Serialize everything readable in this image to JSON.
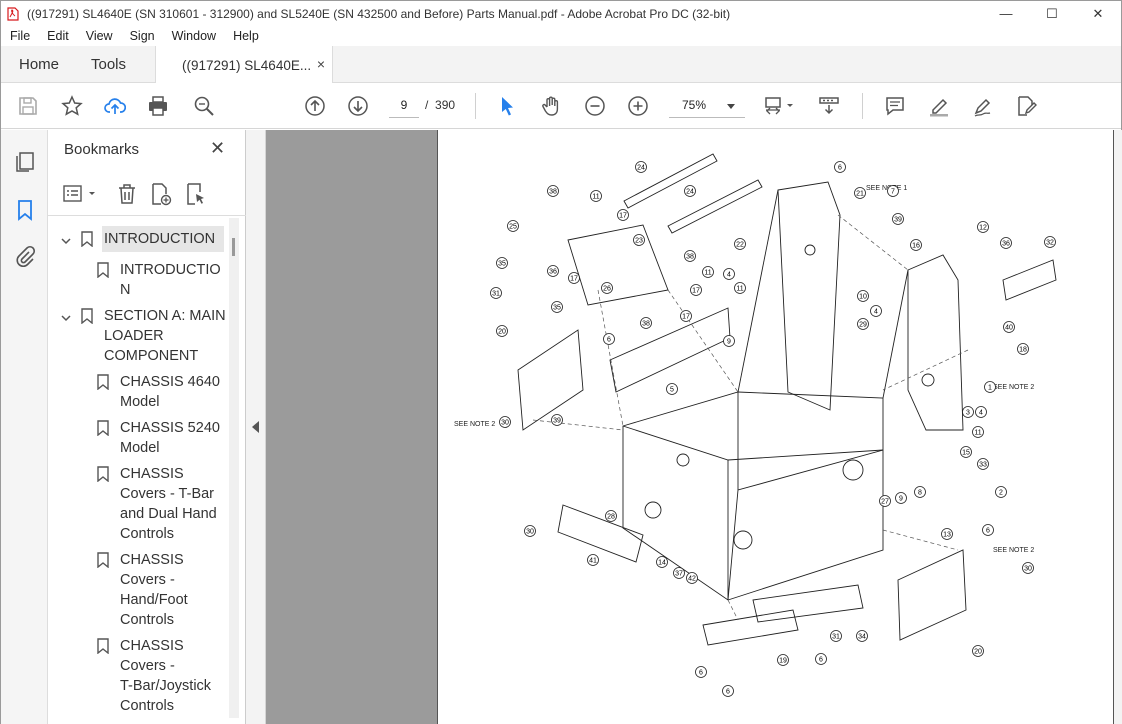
{
  "window": {
    "title": "((917291) SL4640E (SN 310601 - 312900) and SL5240E (SN 432500 and Before) Parts Manual.pdf - Adobe Acrobat Pro DC (32-bit)",
    "controls": [
      "—",
      "☐",
      "✕"
    ]
  },
  "menu": [
    "File",
    "Edit",
    "View",
    "Sign",
    "Window",
    "Help"
  ],
  "tabs": {
    "home": "Home",
    "tools": "Tools",
    "document": "((917291) SL4640E...",
    "close": "×"
  },
  "toolbar": {
    "current_page": "9",
    "page_separator": "/",
    "total_pages": "390",
    "zoom": "75%"
  },
  "bookmarks": {
    "title": "Bookmarks",
    "close": "✕",
    "items": [
      {
        "lines": [
          "INTRODUCTION"
        ],
        "level": 0,
        "expanded": true,
        "selected": true
      },
      {
        "lines": [
          "INTRODUCTIO",
          "N"
        ],
        "level": 1
      },
      {
        "lines": [
          "SECTION A: MAIN",
          "LOADER",
          "COMPONENT"
        ],
        "level": 0,
        "expanded": true
      },
      {
        "lines": [
          "CHASSIS 4640",
          "Model"
        ],
        "level": 1
      },
      {
        "lines": [
          "CHASSIS 5240",
          "Model"
        ],
        "level": 1
      },
      {
        "lines": [
          "CHASSIS",
          "Covers - T-Bar",
          "and Dual Hand",
          "Controls"
        ],
        "level": 1
      },
      {
        "lines": [
          "CHASSIS",
          "Covers -",
          "Hand/Foot",
          "Controls"
        ],
        "level": 1
      },
      {
        "lines": [
          "CHASSIS",
          "Covers -",
          "T-Bar/Joystick",
          "Controls"
        ],
        "level": 1
      }
    ]
  },
  "diagram": {
    "notes": {
      "note1": "SEE NOTE 1",
      "note2_a": "SEE NOTE 2",
      "note2_b": "SEE NOTE 2",
      "note2_c": "SEE NOTE 2"
    },
    "callouts": [
      "24",
      "24",
      "6",
      "21",
      "7",
      "38",
      "11",
      "17",
      "39",
      "22",
      "16",
      "12",
      "36",
      "32",
      "25",
      "23",
      "38",
      "35",
      "36",
      "17",
      "11",
      "4",
      "11",
      "31",
      "26",
      "17",
      "10",
      "4",
      "29",
      "40",
      "20",
      "35",
      "38",
      "17",
      "6",
      "9",
      "18",
      "5",
      "1",
      "4",
      "3",
      "30",
      "39",
      "11",
      "15",
      "33",
      "2",
      "27",
      "9",
      "8",
      "30",
      "41",
      "14",
      "37",
      "42",
      "13",
      "6",
      "30",
      "31",
      "34",
      "6",
      "19",
      "6",
      "6",
      "20",
      "28"
    ]
  },
  "colors": {
    "accent_blue": "#2680eb",
    "viewer_gray": "#9b9b9b",
    "tab_bg": "#f3f3f3",
    "pdf_red": "#d7191c"
  }
}
